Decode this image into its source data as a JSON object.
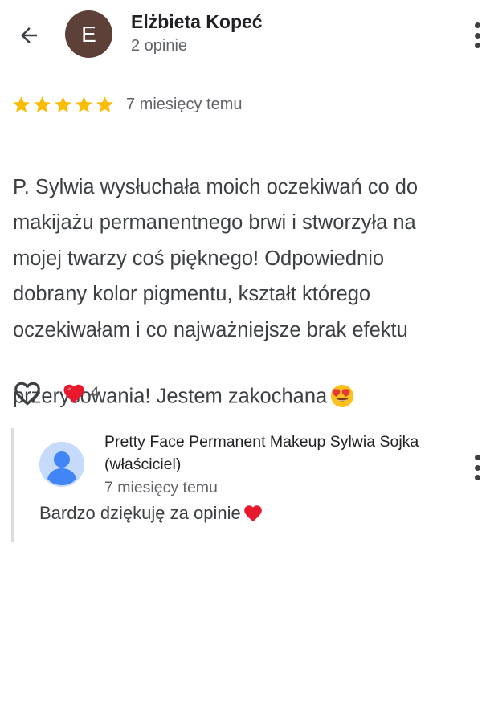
{
  "header": {
    "back_icon": "arrow-back-icon",
    "avatar_letter": "E",
    "avatar_color": "#5d4037",
    "reviewer_name": "Elżbieta Kopeć",
    "review_count": "2 opinie",
    "menu_icon": "more-vert-icon"
  },
  "review": {
    "rating": 5,
    "rating_max": 5,
    "star_color": "#fbbc04",
    "date": "7 miesięcy temu",
    "text": "P. Sylwia wysłuchała moich oczekiwań co do\nmakijażu permanentnego brwi i stworzyła na\nmojej twarzy coś pięknego! Odpowiednio\ndobrany kolor pigmentu, kształt którego\noczekiwałam i co najważniejsze brak efektu\nprzerysowania! Jestem zakochana",
    "trailing_emoji": "heart-eyes-emoji"
  },
  "actions": {
    "like_icon": "heart-outline-icon",
    "reaction_icon": "red-heart-icon",
    "reaction_count": "4"
  },
  "owner_reply": {
    "avatar_icon": "person-avatar-icon",
    "name": "Pretty Face Permanent Makeup Sylwia Sojka (właściciel)",
    "date": "7 miesięcy temu",
    "text": "Bardzo dziękuję za opinie",
    "trailing_emoji": "red-heart-emoji",
    "menu_icon": "more-vert-icon"
  }
}
